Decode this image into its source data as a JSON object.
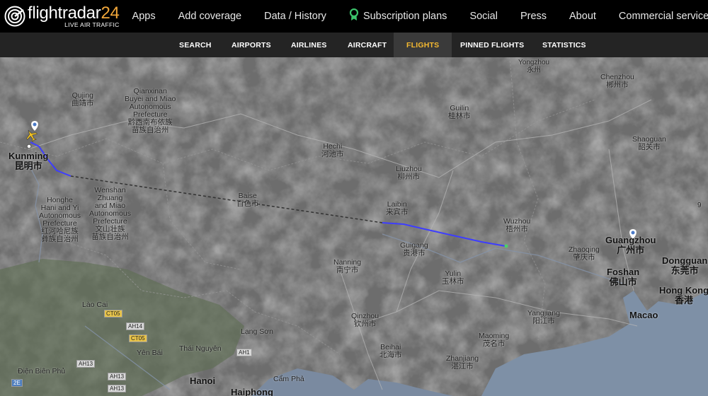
{
  "header": {
    "brand_main": "flightradar",
    "brand_num": "24",
    "brand_sub": "LIVE AIR TRAFFIC",
    "nav": [
      {
        "label": "Apps"
      },
      {
        "label": "Add coverage"
      },
      {
        "label": "Data / History"
      },
      {
        "label": "Subscription plans",
        "icon": "award-icon"
      },
      {
        "label": "Social"
      },
      {
        "label": "Press"
      },
      {
        "label": "About"
      },
      {
        "label": "Commercial services"
      }
    ]
  },
  "subnav": {
    "items": [
      "SEARCH",
      "AIRPORTS",
      "AIRLINES",
      "AIRCRAFT",
      "FLIGHTS",
      "PINNED FLIGHTS",
      "STATISTICS"
    ],
    "active": "FLIGHTS"
  },
  "map": {
    "colors": {
      "land": "#6b6b6b",
      "sea": "#7d8fa3",
      "flight_path": "#3d3dff",
      "planned_path": "#333333",
      "aircraft": "#f0c020",
      "accent": "#f5b930"
    },
    "places": {
      "yongzhou": "Yongzhou\n永州",
      "chenzhou": "Chenzhou\n郴州市",
      "qujing": "Qujing\n曲靖市",
      "qianxinan": "Qianxinan\nBuyei and Miao\nAutonomous\nPrefecture\n黔西南布依族\n苗族自治州",
      "guilin": "Guilin\n桂林市",
      "shaoguan": "Shaoguan\n韶关市",
      "hechi": "Hechi\n河池市",
      "kunming": "Kunming\n昆明市",
      "liuzhou": "Liuzhou\n柳州市",
      "wenshan": "Wenshan\nZhuang\nand Miao\nAutonomous\nPrefecture\n文山壮族\n苗族自治州",
      "baise": "Baise\n百色市",
      "honghe": "Honghe\nHani and Yi\nAutonomous\nPrefecture\n红河哈尼族\n彝族自治州",
      "laibin": "Laibin\n来宾市",
      "wuzhou": "Wuzhou\n梧州市",
      "guangzhou": "Guangzhou\n广州市",
      "guigang": "Guigang\n贵港市",
      "zhaoqing": "Zhaoqing\n肇庆市",
      "dongguan": "Dongguan\n东莞市",
      "nanning": "Nanning\n南宁市",
      "foshan": "Foshan\n佛山市",
      "yulin": "Yulin\n玉林市",
      "hongkong": "Hong Kong\n香港",
      "laocai": "Lào Cai",
      "macao": "Macao",
      "qinzhou": "Qinzhou\n钦州市",
      "yangjiang": "Yangjiang\n阳江市",
      "langson": "Lạng Sơn",
      "maoming": "Maoming\n茂名市",
      "thainguyen": "Thái Nguyên",
      "yenbai": "Yên Bái",
      "beihai": "Beihai\n北海市",
      "zhanjiang": "Zhanjiang\n湛江市",
      "dienbienphu": "Điện Biên Phủ",
      "campha": "Cẩm Phả",
      "hanoi": "Hanoi",
      "haiphong": "Haiphong",
      "nine": "9"
    },
    "roads": [
      "CT05",
      "AH14",
      "CT05",
      "AH13",
      "AH1",
      "AH13",
      "AH13",
      "2E"
    ]
  }
}
